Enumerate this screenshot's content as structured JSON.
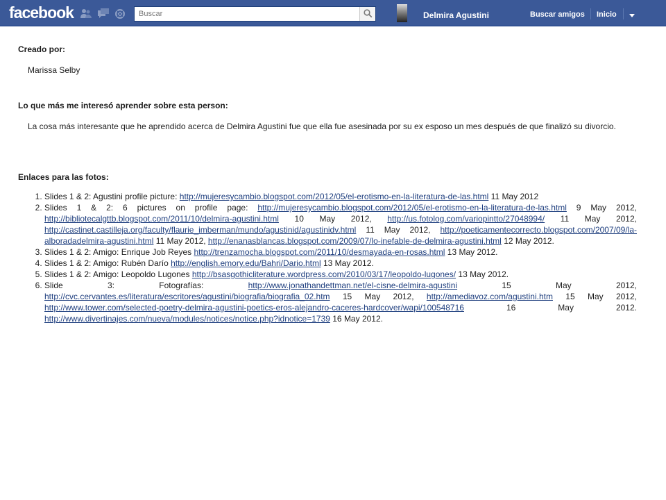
{
  "topbar": {
    "logo": "facebook",
    "search_placeholder": "Buscar",
    "username": "Delmira Agustini",
    "nav": {
      "find_friends": "Buscar amigos",
      "home": "Inicio"
    },
    "colors": {
      "bar": "#3b5998",
      "link": "#1f3f7f"
    },
    "icons": [
      "friend-requests-icon",
      "messages-icon",
      "notifications-icon",
      "search-icon",
      "chevron-down-icon"
    ]
  },
  "content": {
    "created_by_heading": "Creado por:",
    "author": "Marissa Selby",
    "interest_heading": "Lo que más me interesó aprender sobre esta person:",
    "interest_text": "La cosa más interesante que he aprendido acerca de Delmira Agustini fue que ella fue asesinada por su ex esposo un mes después de que finalizó su divorcio.",
    "links_heading": "Enlaces para las fotos:",
    "items": [
      [
        {
          "t": "Slides 1 & 2: Agustini profile picture: "
        },
        {
          "l": "http://mujeresycambio.blogspot.com/2012/05/el-erotismo-en-la-literatura-de-las.html"
        },
        {
          "t": " 11 May 2012"
        }
      ],
      [
        {
          "t": "Slides 1 & 2: 6 pictures on profile page: "
        },
        {
          "l": "http://mujeresycambio.blogspot.com/2012/05/el-erotismo-en-la-literatura-de-las.html"
        },
        {
          "t": " 9 May 2012, "
        },
        {
          "l": "http://bibliotecalgttb.blogspot.com/2011/10/delmira-agustini.html"
        },
        {
          "t": " 10 May 2012, "
        },
        {
          "l": "http://us.fotolog.com/variopintto/27048994/"
        },
        {
          "t": " 11 May 2012, "
        },
        {
          "l": "http://castinet.castilleja.org/faculty/flaurie_imberman/mundo/agustinid/agustinidv.html"
        },
        {
          "t": " 11 May 2012, "
        },
        {
          "l": "http://poeticamentecorrecto.blogspot.com/2007/09/la-alboradadelmira-agustini.html"
        },
        {
          "t": " 11 May 2012, "
        },
        {
          "l": "http://enanasblancas.blogspot.com/2009/07/lo-inefable-de-delmira-agustini.html"
        },
        {
          "t": " 12 May 2012."
        }
      ],
      [
        {
          "t": "Slides 1 & 2: Amigo: Enrique Job Reyes "
        },
        {
          "l": "http://trenzamocha.blogspot.com/2011/10/desmayada-en-rosas.html"
        },
        {
          "t": " 13 May 2012."
        }
      ],
      [
        {
          "t": "Slides 1 & 2: Amigo: Rubén Darío "
        },
        {
          "l": "http://english.emory.edu/Bahri/Dario.html"
        },
        {
          "t": " 13 May 2012."
        }
      ],
      [
        {
          "t": "Slides 1 & 2: Amigo: Leopoldo Lugones "
        },
        {
          "l": "http://bsasgothicliterature.wordpress.com/2010/03/17/leopoldo-lugones/"
        },
        {
          "t": " 13 May 2012."
        }
      ],
      [
        {
          "t": "Slide 3: Fotografías: "
        },
        {
          "l": "http://www.jonathandettman.net/el-cisne-delmira-agustini"
        },
        {
          "t": " 15 May 2012, "
        },
        {
          "l": "http://cvc.cervantes.es/literatura/escritores/agustini/biografia/biografia_02.htm"
        },
        {
          "t": " 15 May 2012, "
        },
        {
          "l": "http://amediavoz.com/agustini.htm"
        },
        {
          "t": " 15 May 2012, "
        },
        {
          "l": "http://www.tower.com/selected-poetry-delmira-agustini-poetics-eros-alejandro-caceres-hardcover/wapi/100548716"
        },
        {
          "t": " 16 May 2012. "
        },
        {
          "l": "http://www.divertinajes.com/nueva/modules/notices/notice.php?idnotice=1739"
        },
        {
          "t": " 16 May 2012."
        }
      ]
    ]
  }
}
